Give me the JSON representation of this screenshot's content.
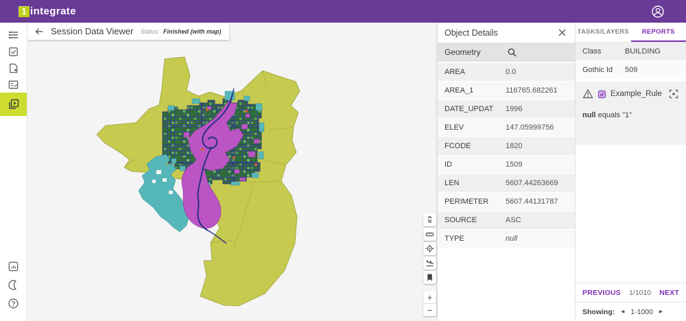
{
  "header": {
    "logo_mark": "1",
    "logo_text": "integrate",
    "brand_color": "#693a96",
    "logo_mark_bg": "#bdd013"
  },
  "toolbar": {
    "title": "Session Data Viewer",
    "status_label": "Status:",
    "status_value": "Finished (with map)"
  },
  "sidebar": {
    "active_item": "session-viewer",
    "active_bg": "#cddc2e",
    "items": [
      "menu",
      "tasks-check",
      "data-file",
      "rules-list",
      "session-viewer"
    ],
    "bottom_items": [
      "dashboard",
      "dark-mode",
      "help"
    ]
  },
  "map": {
    "controls": [
      "north-up",
      "measure",
      "locate",
      "flight-land",
      "bookmark"
    ],
    "zoom_in": "+",
    "zoom_out": "−",
    "palette": {
      "background": "#f4f4f4",
      "boundary": "#c6ca4f",
      "water": "#56b7ba",
      "urban": "#ba55c3",
      "buildings": "#2f6e38",
      "roads": "#30338c",
      "points": "#c7623a"
    }
  },
  "object_details": {
    "title": "Object Details",
    "geometry_label": "Geometry",
    "rows": [
      {
        "label": "AREA",
        "value": "0.0"
      },
      {
        "label": "AREA_1",
        "value": "116765.682261"
      },
      {
        "label": "DATE_UPDAT",
        "value": "1996"
      },
      {
        "label": "ELEV",
        "value": "147.05999756"
      },
      {
        "label": "FCODE",
        "value": "1820"
      },
      {
        "label": "ID",
        "value": "1509"
      },
      {
        "label": "LEN",
        "value": "5607.44263669"
      },
      {
        "label": "PERIMETER",
        "value": "5607.44131787"
      },
      {
        "label": "SOURCE",
        "value": "ASC"
      },
      {
        "label": "TYPE",
        "value": "null"
      }
    ]
  },
  "right_panel": {
    "tabs": [
      {
        "label": "TASKS/LAYERS",
        "active": false
      },
      {
        "label": "REPORTS",
        "active": true
      }
    ],
    "accent": "#7b2fb5",
    "properties": [
      {
        "label": "Class",
        "value": "BUILDING"
      },
      {
        "label": "Gothic Id",
        "value": "509"
      }
    ],
    "rule": {
      "name": "Example_Rule",
      "detail_bold": "null",
      "detail_rest": " equals \"1\""
    },
    "pagination": {
      "previous": "PREVIOUS",
      "position": "1/1010",
      "next": "NEXT"
    },
    "showing": {
      "label": "Showing:",
      "prev_icon": "◂",
      "range": "1-1000",
      "next_icon": "▸"
    }
  }
}
